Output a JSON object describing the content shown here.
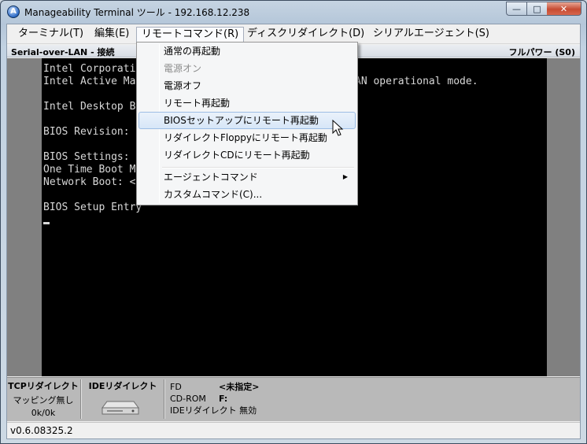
{
  "window": {
    "title": "Manageability Terminal ツール - 192.168.12.238"
  },
  "menubar": [
    {
      "label": "ターミナル(T)"
    },
    {
      "label": "編集(E)"
    },
    {
      "label": "リモートコマンド(R)"
    },
    {
      "label": "ディスクリダイレクト(D)"
    },
    {
      "label": "シリアルエージェント(S)"
    }
  ],
  "status": {
    "left": "Serial-over-LAN - 接続",
    "right": "フルパワー (S0)"
  },
  "terminal": {
    "lines": [
      "Intel Corporati",
      "Intel Active Ma",
      "",
      "Intel Desktop B",
      "",
      "BIOS Revision:",
      "",
      "BIOS Settings:",
      "One Time Boot M",
      "Network Boot: <",
      "",
      "BIOS Setup Entry"
    ],
    "line2_tail": "AN operational mode."
  },
  "remote_menu": {
    "items": [
      {
        "label": "通常の再起動"
      },
      {
        "label": "電源オン"
      },
      {
        "label": "電源オフ"
      },
      {
        "label": "リモート再起動"
      },
      {
        "label": "BIOSセットアップにリモート再起動"
      },
      {
        "label": "リダイレクトFloppyにリモート再起動"
      },
      {
        "label": "リダイレクトCDにリモート再起動"
      },
      {
        "label": "エージェントコマンド"
      },
      {
        "label": "カスタムコマンド(C)..."
      }
    ],
    "arrow": "▶"
  },
  "bottom": {
    "tcp": {
      "title": "TCPリダイレクト",
      "mapping": "マッピング無し",
      "rate": "0k/0k"
    },
    "ide": {
      "title": "IDEリダイレクト"
    },
    "ide_info": {
      "fd_label": "FD",
      "fd_value": "<未指定>",
      "cd_label": "CD-ROM",
      "cd_value": "F:",
      "status": "IDEリダイレクト 無効"
    }
  },
  "version": "v0.6.08325.2",
  "colors": {
    "terminal_bg": "#000000",
    "terminal_fg": "#d8d8d8",
    "highlight": "#d7e6f7"
  }
}
